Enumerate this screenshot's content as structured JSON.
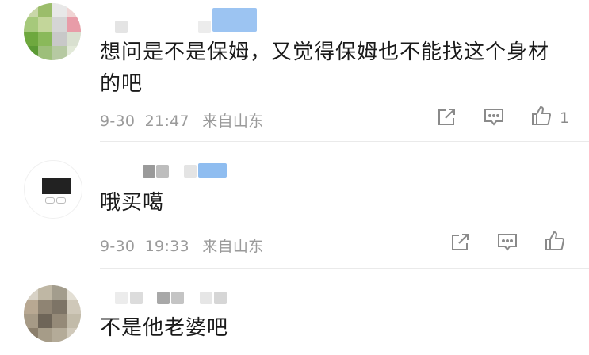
{
  "comments": [
    {
      "text_line1": "想问是不是保姆，又觉得保姆也不能找这个身材",
      "text_line2": "的吧",
      "date": "9-30",
      "time": "21:47",
      "location": "来自山东",
      "like_count": "1"
    },
    {
      "text_line1": "哦买噶",
      "date": "9-30",
      "time": "19:33",
      "location": "来自山东"
    },
    {
      "text_line1": "不是他老婆吧"
    }
  ],
  "icons": {
    "share": "share-icon",
    "comment": "comment-icon",
    "like": "like-icon"
  },
  "colors": {
    "text": "#1a1a1a",
    "meta": "#9a9a9a",
    "icon": "#8a8a8a"
  }
}
